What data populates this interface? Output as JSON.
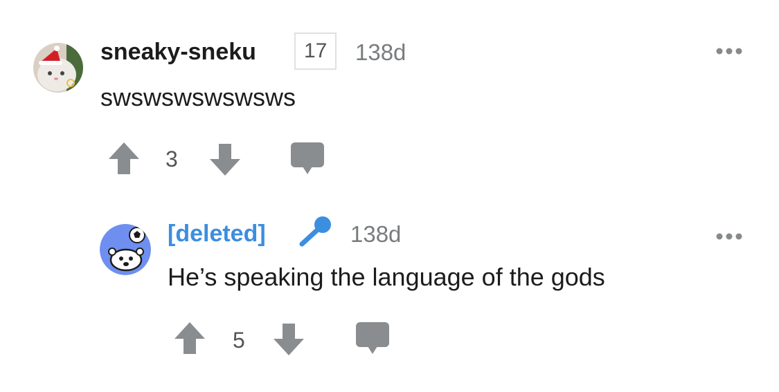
{
  "comment": {
    "username": "sneaky-sneku",
    "flair": "17",
    "timestamp": "138d",
    "body": "swswswswswsws",
    "upvotes": "3",
    "avatar_icon": "cat-santa-hat-avatar",
    "more_icon": "more-dots-icon"
  },
  "reply": {
    "username": "[deleted]",
    "timestamp": "138d",
    "body": "He’s speaking the language of the gods",
    "upvotes": "5",
    "avatar_icon": "snoo-soccer-avatar",
    "badge_icon": "microphone-icon",
    "more_icon": "more-dots-icon"
  },
  "colors": {
    "icon_gray": "#8a8d8f",
    "deleted_blue": "#3c8ee0",
    "avatar_blue": "#6e8ff0"
  }
}
